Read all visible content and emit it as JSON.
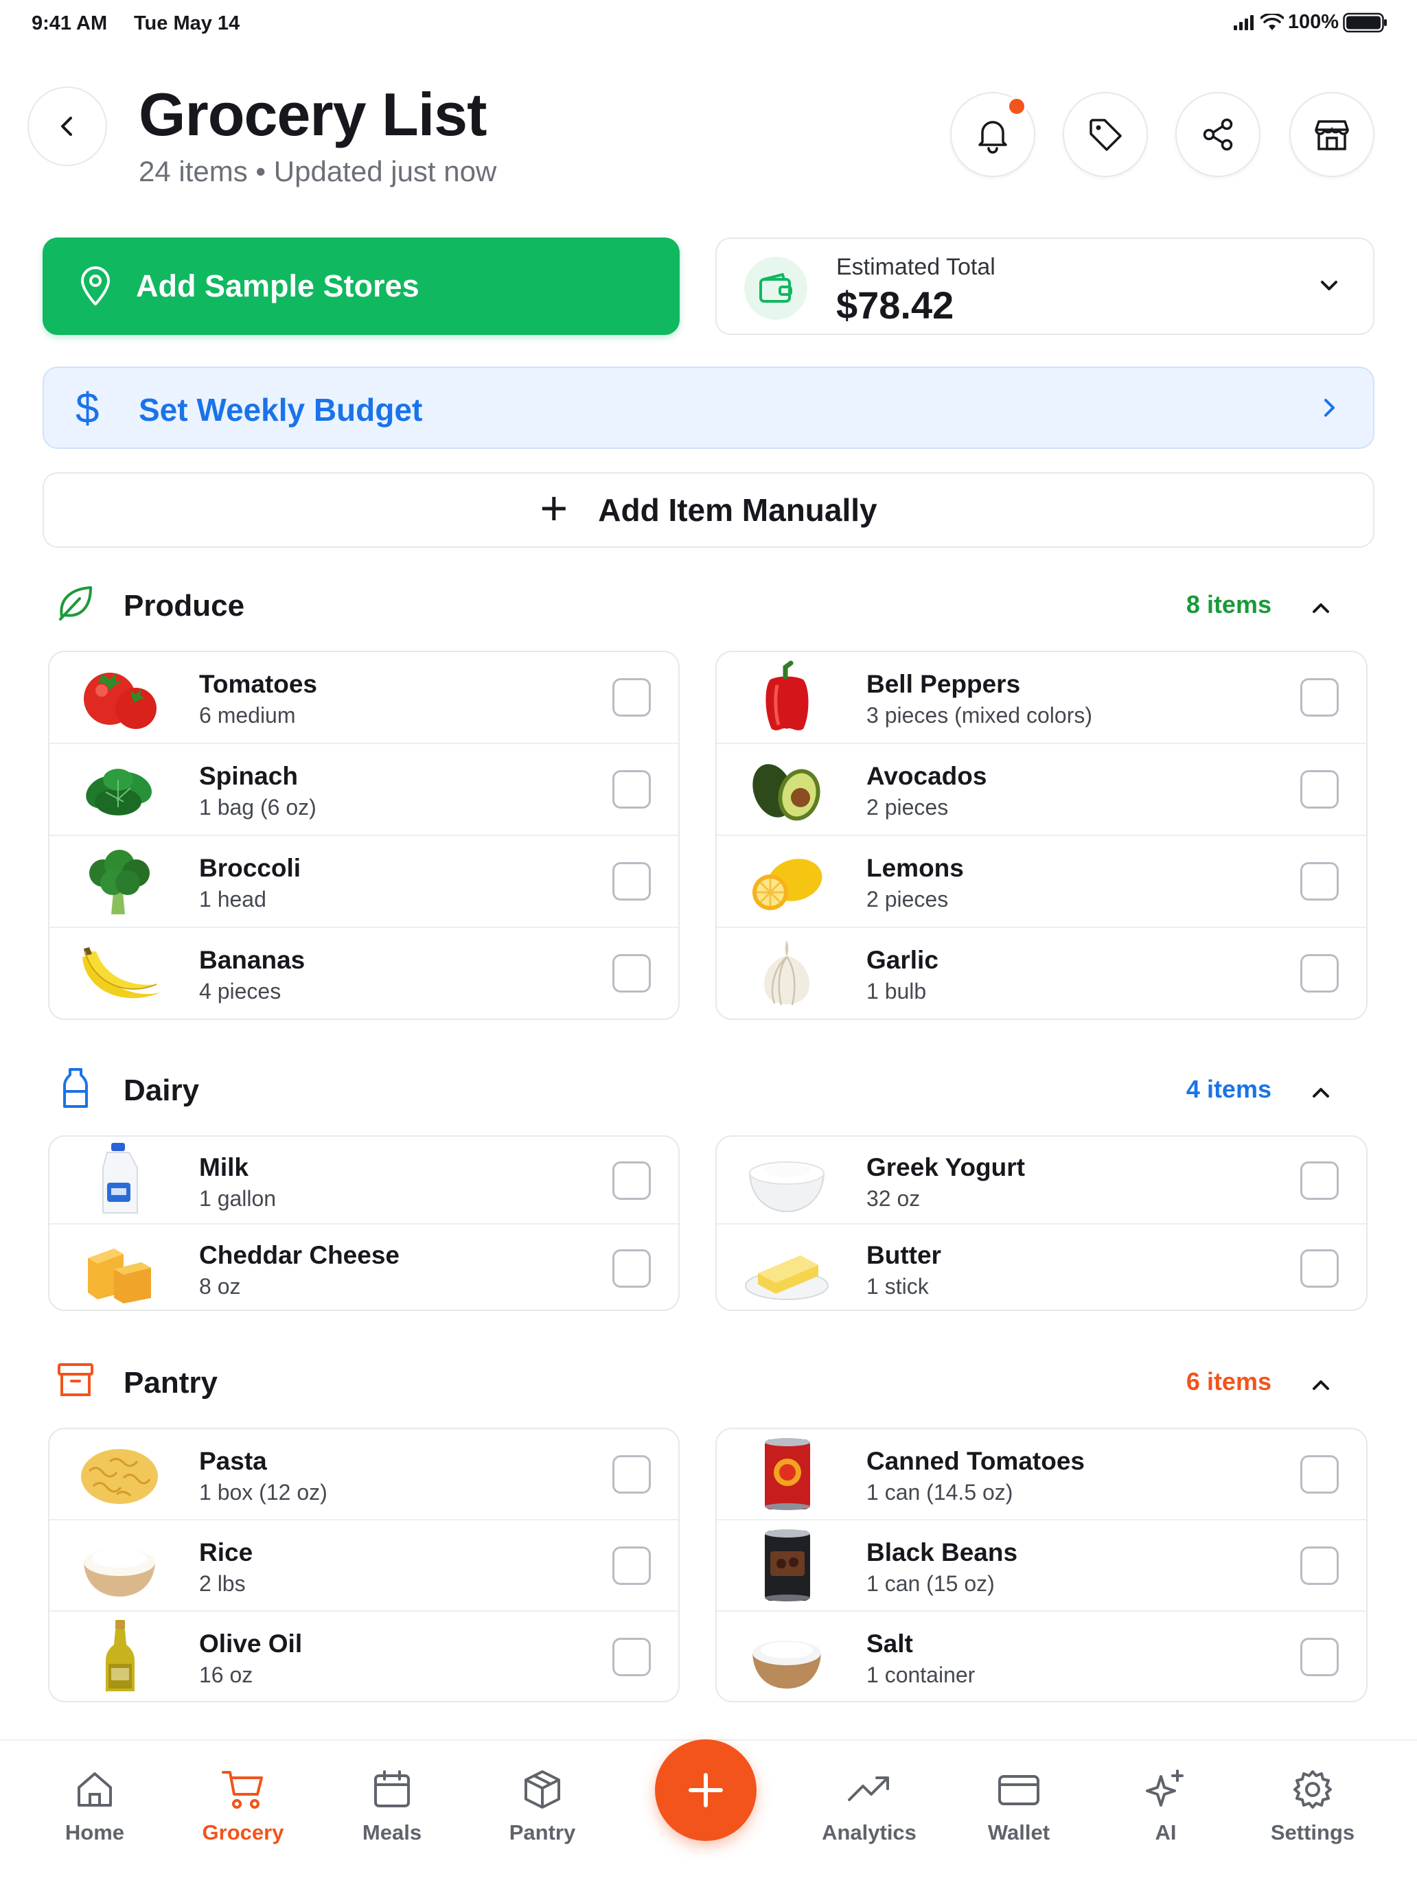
{
  "status": {
    "time": "9:41 AM",
    "date": "Tue May 14",
    "battery": "100%"
  },
  "header": {
    "title": "Grocery List",
    "subtitle": "24 items • Updated just now"
  },
  "stores_button": {
    "label": "Add Sample Stores"
  },
  "estimate": {
    "label": "Estimated Total",
    "value": "$78.42"
  },
  "budget": {
    "label": "Set Weekly Budget"
  },
  "add_manual": {
    "label": "Add Item Manually"
  },
  "colors": {
    "green": "#10b860",
    "blue": "#1a73e8",
    "orange": "#f2541b",
    "produce": "#1a9a3a"
  },
  "sections": {
    "produce": {
      "name": "Produce",
      "count": "8 items",
      "left": [
        {
          "name": "Tomatoes",
          "qty": "6 medium",
          "icon": "tomato"
        },
        {
          "name": "Spinach",
          "qty": "1 bag (6 oz)",
          "icon": "spinach"
        },
        {
          "name": "Broccoli",
          "qty": "1 head",
          "icon": "broccoli"
        },
        {
          "name": "Bananas",
          "qty": "4 pieces",
          "icon": "banana"
        }
      ],
      "right": [
        {
          "name": "Bell Peppers",
          "qty": "3 pieces (mixed colors)",
          "icon": "bell-pepper"
        },
        {
          "name": "Avocados",
          "qty": "2 pieces",
          "icon": "avocado"
        },
        {
          "name": "Lemons",
          "qty": "2 pieces",
          "icon": "lemon"
        },
        {
          "name": "Garlic",
          "qty": "1 bulb",
          "icon": "garlic"
        }
      ]
    },
    "dairy": {
      "name": "Dairy",
      "count": "4 items",
      "left": [
        {
          "name": "Milk",
          "qty": "1 gallon",
          "icon": "milk-jug"
        },
        {
          "name": "Cheddar Cheese",
          "qty": "8 oz",
          "icon": "cheese"
        }
      ],
      "right": [
        {
          "name": "Greek Yogurt",
          "qty": "32 oz",
          "icon": "yogurt-bowl"
        },
        {
          "name": "Butter",
          "qty": "1 stick",
          "icon": "butter"
        }
      ]
    },
    "pantry": {
      "name": "Pantry",
      "count": "6 items",
      "left": [
        {
          "name": "Pasta",
          "qty": "1 box (12 oz)",
          "icon": "pasta"
        },
        {
          "name": "Rice",
          "qty": "2 lbs",
          "icon": "rice-bowl"
        },
        {
          "name": "Olive Oil",
          "qty": "16 oz",
          "icon": "olive-oil-bottle"
        }
      ],
      "right": [
        {
          "name": "Canned Tomatoes",
          "qty": "1 can (14.5 oz)",
          "icon": "tomato-can"
        },
        {
          "name": "Black Beans",
          "qty": "1 can (15 oz)",
          "icon": "bean-can"
        },
        {
          "name": "Salt",
          "qty": "1 container",
          "icon": "salt-bowl"
        }
      ]
    }
  },
  "nav": {
    "home": "Home",
    "grocery": "Grocery",
    "meals": "Meals",
    "pantry": "Pantry",
    "analytics": "Analytics",
    "wallet": "Wallet",
    "ai": "AI",
    "settings": "Settings"
  }
}
